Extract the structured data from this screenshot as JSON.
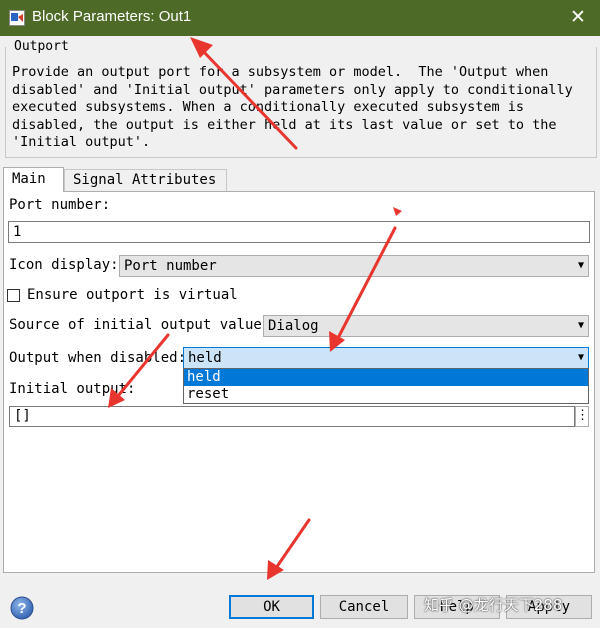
{
  "window": {
    "title": "Block Parameters: Out1",
    "close_glyph": "✕"
  },
  "group": {
    "legend": "Outport",
    "description": [
      "Provide an output port for a subsystem or model.  The 'Output when",
      "disabled' and 'Initial output' parameters only apply to conditionally",
      "executed subsystems. When a conditionally executed subsystem is",
      "disabled, the output is either held at its last value or set to the",
      "'Initial output'."
    ]
  },
  "tabs": [
    {
      "label": "Main"
    },
    {
      "label": "Signal Attributes"
    }
  ],
  "form": {
    "port_number_label": "Port number:",
    "port_number_value": "1",
    "icon_display_label": "Icon display:",
    "icon_display_value": "Port number",
    "virtual_label": "Ensure outport is virtual",
    "virtual_checked": false,
    "source_label": "Source of initial output value:",
    "source_value": "Dialog",
    "output_disabled_label": "Output when disabled:",
    "output_disabled_value": "held",
    "output_disabled_options": [
      "held",
      "reset"
    ],
    "initial_output_label": "Initial output:",
    "initial_output_value": "[]",
    "ellipsis": "⋮"
  },
  "buttons": {
    "ok": "OK",
    "cancel": "Cancel",
    "help": "Help",
    "apply": "Apply"
  },
  "watermark": "知乎 @龙行天下288",
  "colors": {
    "titlebar": "#4d6b26",
    "selection": "#0078d7",
    "arrow": "#e8352e"
  },
  "icons": {
    "app": "simulink-block-icon",
    "help": "help-question-icon",
    "close": "close-icon",
    "dropdown": "chevron-down-icon"
  }
}
